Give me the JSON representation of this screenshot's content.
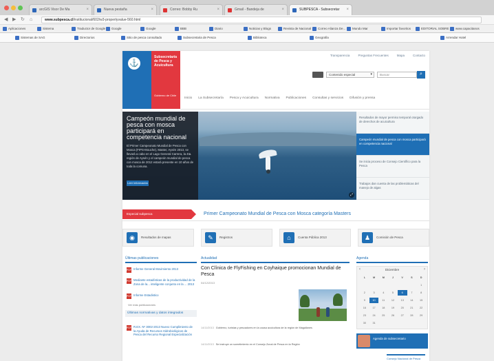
{
  "browser": {
    "tabs": [
      {
        "label": "arcGIS Visor De Ma",
        "fav": "blue"
      },
      {
        "label": "Nueva pestaña",
        "fav": "blue"
      },
      {
        "label": "Correo: Bobby Ru",
        "fav": "red"
      },
      {
        "label": "Gmail - Bandeja de",
        "fav": "red"
      },
      {
        "label": "SUBPESCA - Subsecretar",
        "fav": "blue"
      }
    ],
    "url_host": "www.subpesca.cl",
    "url_path": "/institucional/602/w3-propertyvalue-560.html",
    "bookmarks": [
      "Aplicaciones",
      "Sistema",
      "Traductor de Google",
      "Google",
      "Google",
      "BBB",
      "Diario",
      "Noticias y Blogs",
      "Revista de Nacional",
      "Correo Alianza De...",
      "Mundo Mar",
      "Importar favoritos",
      "EDITORIAL SOBRE",
      "www.capacitanos"
    ],
    "bookmarks2": [
      "Sistemas de SAG",
      "Directorios",
      "Sitio de pesca consultado",
      "Subsecretaria de Pesca",
      "Biblioteca",
      "Geografia",
      "Arrendar Hotel"
    ]
  },
  "site": {
    "logo_name": "Subsecretaría de Pesca y Acuicultura",
    "logo_sub": "Gobierno de Chile",
    "top_links": [
      "Transparencia",
      "Preguntas Frecuentes",
      "Mapa",
      "Contacto"
    ],
    "select_label": "Contenido especial",
    "search_placeholder": "Buscar",
    "nav": [
      "Inicio",
      "La Subsecretaría",
      "Pesca y Acuicultura",
      "Normativa",
      "Publicaciones",
      "Consultas y servicios",
      "Difusión y prensa"
    ]
  },
  "hero": {
    "title": "Campeón mundial de pesca con mosca participará en competencia nacional",
    "body": "El Primer Campeonato Mundial de Pesca con Mosca (FIPS-Mouche), Master, Aysén 2013, se llevará a cabo en el Lago General Carrera, la 4ta. región de Aysén y el campeón mundial de pesca con mosca de 2012 estará presente en 10 años de toda la comuna.",
    "more": "Leer información",
    "side_items": [
      "Resultados de mayor permiso temporal otorgado de derechos de acuicultura",
      "Campeón mundial de pesca con mosca participará en competencia nacional",
      "Se inicia proceso de Consejo Científico para la Pesca",
      "Trabajos dan cuenta de las problemáticas del manejo de algas"
    ]
  },
  "banner": {
    "label": "Especial subpesca",
    "text": "Primer Campeonato Mundial de Pesca con Mosca categoría Masters"
  },
  "quick": [
    {
      "label": "Resultados de mapas",
      "color": "#1f6fb5",
      "icon": "map-icon"
    },
    {
      "label": "Registros",
      "color": "#1f6fb5",
      "icon": "pencil-icon"
    },
    {
      "label": "Cuenta Pública 2013",
      "color": "#1f6fb5",
      "icon": "building-icon"
    },
    {
      "label": "Comisión de Pesca",
      "color": "#1f6fb5",
      "icon": "people-icon"
    }
  ],
  "columns": {
    "pubs_header": "Últimas publicaciones",
    "news_header": "Actualidad",
    "agenda_header": "Agenda",
    "pubs": [
      "Informe General Movimiento 2013",
      "Mediante estadísticas de la productividad de la Zona de la... inteligente conjunto en la ... 2013",
      "Informe Estadistico"
    ],
    "see_all": "Ver más publicaciones",
    "norm_header": "Últimas normativas y datos integrados",
    "norm_item": "R.EX. Nº 3002-2013 Nuevo Cumplimiento de la Ayuda de Recursos Hidrobiológicos de Pesca del Recurso Regional Especialización",
    "news_title": "Con Clínica de FlyFishing en Coyhaique promocionan Mundial de Pesca",
    "news_date": "04/12/2013",
    "news_items": [
      {
        "date": "14/11/2013",
        "text": "Gobierno, turistas y pescadores en la causa acuicultura de la región de Magallanes"
      },
      {
        "date": "14/11/2013",
        "text": "Se instruye un sometimiento en el Consejo Zonal de Pesca en la Región"
      }
    ],
    "cal_month": "Diciembre",
    "cal_days_head": [
      "L",
      "M",
      "M",
      "J",
      "V",
      "S",
      "D"
    ],
    "cal_days": [
      "",
      "",
      "",
      "",
      "",
      "",
      "1",
      "2",
      "3",
      "4",
      "5",
      "6",
      "7",
      "8",
      "9",
      "10",
      "11",
      "12",
      "13",
      "14",
      "15",
      "16",
      "17",
      "18",
      "19",
      "20",
      "21",
      "22",
      "23",
      "24",
      "25",
      "26",
      "27",
      "28",
      "29",
      "30",
      "31"
    ],
    "agenda_text": "Agenda de subsecretario",
    "consejo": "Consejo Nacional de Pesca Consejo Científico"
  }
}
